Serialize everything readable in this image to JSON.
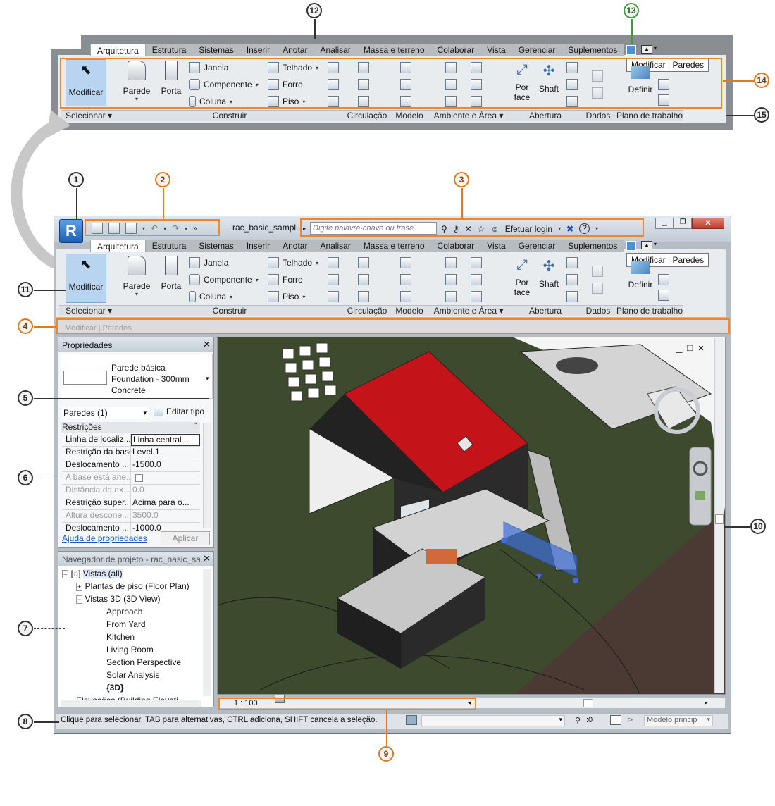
{
  "callouts": [
    "1",
    "2",
    "3",
    "4",
    "5",
    "6",
    "7",
    "8",
    "9",
    "10",
    "11",
    "12",
    "13",
    "14",
    "15"
  ],
  "ribbon_tabs": [
    "Arquitetura",
    "Estrutura",
    "Sistemas",
    "Inserir",
    "Anotar",
    "Analisar",
    "Massa e terreno",
    "Colaborar",
    "Vista",
    "Gerenciar",
    "Suplementos"
  ],
  "ribbon": {
    "modificar": "Modificar",
    "parede": "Parede",
    "porta": "Porta",
    "janela": "Janela",
    "componente": "Componente",
    "coluna": "Coluna",
    "telhado": "Telhado",
    "forro": "Forro",
    "piso": "Piso",
    "por": "Por",
    "face": "face",
    "shaft": "Shaft",
    "definir": "Definir",
    "context_tab": "Modificar | Paredes",
    "panels": {
      "selecionar": "Selecionar",
      "construir": "Construir",
      "circulacao": "Circulação",
      "modelo": "Modelo",
      "ambiente": "Ambiente e Área",
      "abertura": "Abertura",
      "dados": "Dados",
      "plano": "Plano de trabalho"
    }
  },
  "titlebar": {
    "doc_title": "rac_basic_sampl...",
    "search_placeholder": "Digite palavra-chave ou frase",
    "login": "Efetuar login"
  },
  "options_bar": "Modificar | Paredes",
  "properties": {
    "title": "Propriedades",
    "type_line1": "Parede básica",
    "type_line2": "Foundation - 300mm",
    "type_line3": "Concrete",
    "selector": "Paredes (1)",
    "edit_type": "Editar tipo",
    "group": "Restrições",
    "rows": [
      {
        "k": "Linha de localiz...",
        "v": "Linha central ..."
      },
      {
        "k": "Restrição da base",
        "v": "Level 1"
      },
      {
        "k": "Deslocamento ...",
        "v": "-1500.0"
      },
      {
        "k": "A base está ane...",
        "v": ""
      },
      {
        "k": "Distância da ex...",
        "v": "0.0"
      },
      {
        "k": "Restrição super...",
        "v": "Acima para o..."
      },
      {
        "k": "Altura descone...",
        "v": "3500.0"
      },
      {
        "k": "Deslocamento ...",
        "v": "-1000.0"
      }
    ],
    "help": "Ajuda de propriedades",
    "apply": "Aplicar"
  },
  "browser": {
    "title": "Navegador de projeto - rac_basic_sa...",
    "root": "Vistas (all)",
    "floor": "Plantas de piso (Floor Plan)",
    "views3d": "Vistas 3D (3D View)",
    "items": [
      "Approach",
      "From Yard",
      "Kitchen",
      "Living Room",
      "Section Perspective",
      "Solar Analysis",
      "{3D}"
    ],
    "cut": "Elevações (Building Elevati..."
  },
  "viewbar": {
    "scale": "1 : 100"
  },
  "status": {
    "text": "Clique para selecionar, TAB para alternativas, CTRL adiciona, SHIFT cancela a seleção.",
    "count": ":0",
    "model": "Modelo princip"
  },
  "colors": {
    "accent": "#f0852a",
    "roof": "#c4141a",
    "terrain": "#3f4a2c",
    "road": "#4a3a35",
    "selected_wall": "#3f6fd8"
  }
}
